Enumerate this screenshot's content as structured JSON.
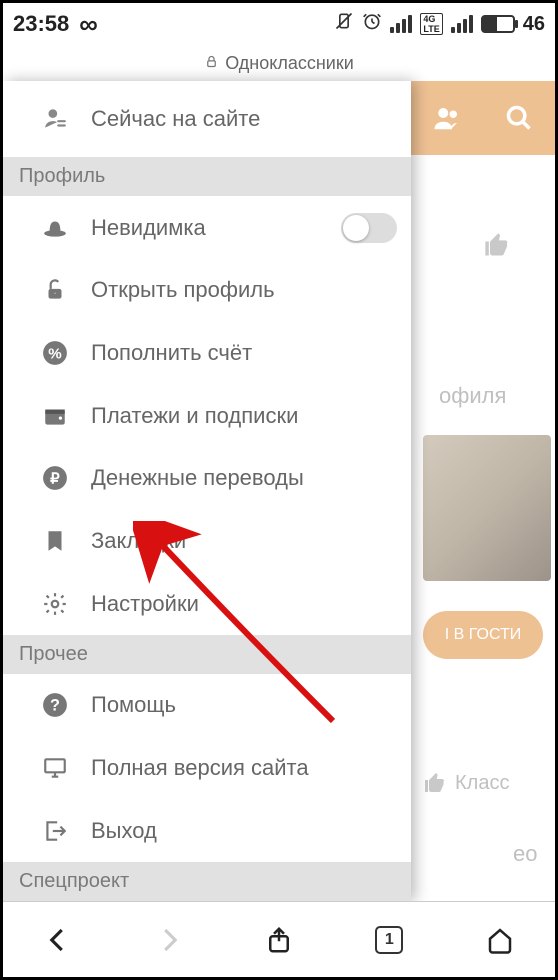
{
  "status": {
    "time": "23:58",
    "net_type": "4G LTE",
    "battery_pct": "46"
  },
  "header": {
    "title": "Одноклассники"
  },
  "sidebar": {
    "top_item": {
      "label": "Сейчас на сайте"
    },
    "section_profile": "Профиль",
    "items_profile": [
      {
        "label": "Невидимка",
        "has_toggle": true
      },
      {
        "label": "Открыть профиль"
      },
      {
        "label": "Пополнить счёт"
      },
      {
        "label": "Платежи и подписки"
      },
      {
        "label": "Денежные переводы"
      },
      {
        "label": "Закладки"
      },
      {
        "label": "Настройки"
      }
    ],
    "section_other": "Прочее",
    "items_other": [
      {
        "label": "Помощь"
      },
      {
        "label": "Полная версия сайта"
      },
      {
        "label": "Выход"
      }
    ],
    "section_special": "Спецпроект"
  },
  "right": {
    "like_single": "",
    "profile_fragment": "офиля",
    "guests_btn": "І В ГОСТИ",
    "class_label": "Класс",
    "video_fragment": "ео"
  },
  "bottom": {
    "tab_count": "1"
  }
}
